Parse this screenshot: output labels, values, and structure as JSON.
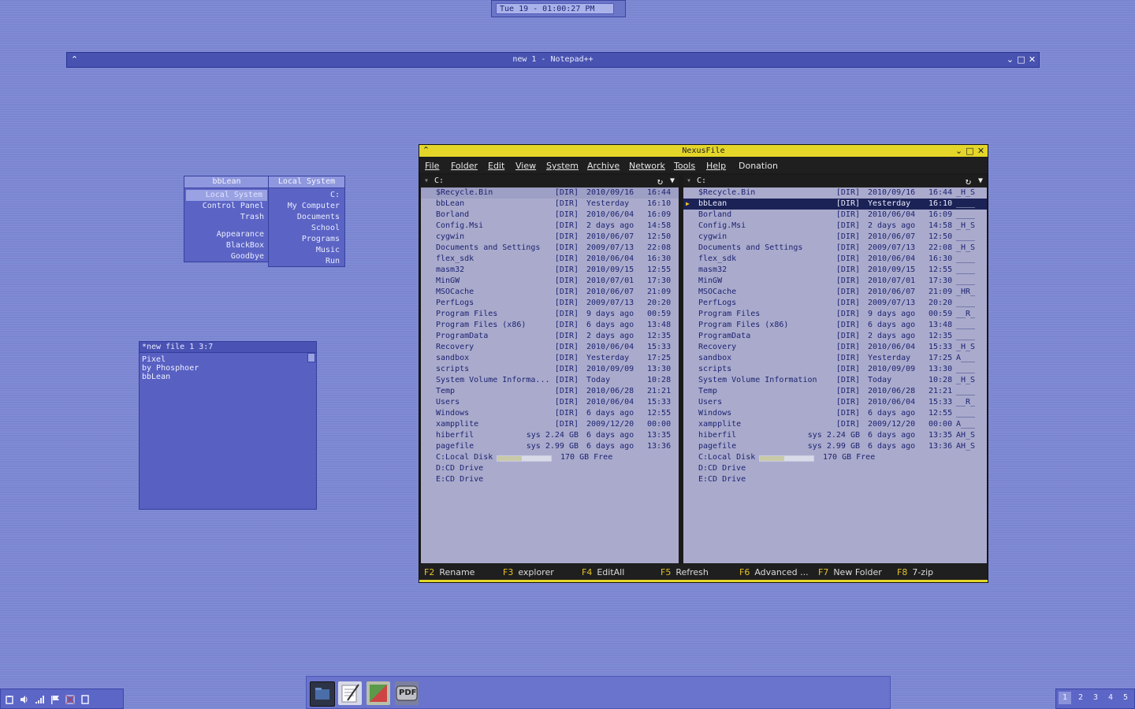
{
  "clock": {
    "text": "Tue 19 - 01:00:27 PM"
  },
  "notepad": {
    "title": "new  1 - Notepad++"
  },
  "bblean_menu": {
    "title": "bbLean",
    "items": [
      {
        "label": "Local System",
        "selected": true
      },
      {
        "label": "Control Panel"
      },
      {
        "label": "Trash"
      },
      {
        "label": "Appearance"
      },
      {
        "label": "BlackBox"
      },
      {
        "label": "Goodbye"
      }
    ]
  },
  "local_system_menu": {
    "title": "Local System",
    "items": [
      "C:",
      "My Computer",
      "Documents",
      "School",
      "Programs",
      "Music",
      "Run"
    ]
  },
  "editor": {
    "title": "*new file 1   3:7",
    "lines": [
      "Pixel",
      "by Phosphoer",
      "bbLean"
    ]
  },
  "nexusfile": {
    "title": "NexusFile",
    "menus": [
      "File",
      "Folder",
      "Edit",
      "View",
      "System",
      "Archive",
      "Network",
      "Tools",
      "Help",
      "Donation"
    ],
    "left_path": "C:",
    "right_path": "C:",
    "rows": [
      {
        "name": "$Recycle.Bin",
        "left_name": "$Recycle.Bin",
        "type": "[DIR]",
        "date": "2010/09/16",
        "time": "16:44",
        "attr": "_H_S"
      },
      {
        "name": "bbLean",
        "left_name": "bbLean",
        "type": "[DIR]",
        "date": "Yesterday",
        "time": "16:10",
        "attr": "____"
      },
      {
        "name": "Borland",
        "left_name": "Borland",
        "type": "[DIR]",
        "date": "2010/06/04",
        "time": "16:09",
        "attr": "____"
      },
      {
        "name": "Config.Msi",
        "left_name": "Config.Msi",
        "type": "[DIR]",
        "date": "2 days ago",
        "time": "14:58",
        "attr": "_H_S"
      },
      {
        "name": "cygwin",
        "left_name": "cygwin",
        "type": "[DIR]",
        "date": "2010/06/07",
        "time": "12:50",
        "attr": "____"
      },
      {
        "name": "Documents and Settings",
        "left_name": "Documents and Settings",
        "type": "[DIR]",
        "date": "2009/07/13",
        "time": "22:08",
        "attr": "_H_S"
      },
      {
        "name": "flex_sdk",
        "left_name": "flex_sdk",
        "type": "[DIR]",
        "date": "2010/06/04",
        "time": "16:30",
        "attr": "____"
      },
      {
        "name": "masm32",
        "left_name": "masm32",
        "type": "[DIR]",
        "date": "2010/09/15",
        "time": "12:55",
        "attr": "____"
      },
      {
        "name": "MinGW",
        "left_name": "MinGW",
        "type": "[DIR]",
        "date": "2010/07/01",
        "time": "17:30",
        "attr": "____"
      },
      {
        "name": "MSOCache",
        "left_name": "MSOCache",
        "type": "[DIR]",
        "date": "2010/06/07",
        "time": "21:09",
        "attr": "_HR_"
      },
      {
        "name": "PerfLogs",
        "left_name": "PerfLogs",
        "type": "[DIR]",
        "date": "2009/07/13",
        "time": "20:20",
        "attr": "____"
      },
      {
        "name": "Program Files",
        "left_name": "Program Files",
        "type": "[DIR]",
        "date": "9 days ago",
        "time": "00:59",
        "attr": "__R_"
      },
      {
        "name": "Program Files (x86)",
        "left_name": "Program Files (x86)",
        "type": "[DIR]",
        "date": "6 days ago",
        "time": "13:48",
        "attr": "____"
      },
      {
        "name": "ProgramData",
        "left_name": "ProgramData",
        "type": "[DIR]",
        "date": "2 days ago",
        "time": "12:35",
        "attr": "____"
      },
      {
        "name": "Recovery",
        "left_name": "Recovery",
        "type": "[DIR]",
        "date": "2010/06/04",
        "time": "15:33",
        "attr": "_H_S"
      },
      {
        "name": "sandbox",
        "left_name": "sandbox",
        "type": "[DIR]",
        "date": "Yesterday",
        "time": "17:25",
        "attr": "A___"
      },
      {
        "name": "scripts",
        "left_name": "scripts",
        "type": "[DIR]",
        "date": "2010/09/09",
        "time": "13:30",
        "attr": "____"
      },
      {
        "name": "System Volume Information",
        "left_name": "System Volume Informa...",
        "type": "[DIR]",
        "date": "Today",
        "time": "10:28",
        "attr": "_H_S"
      },
      {
        "name": "Temp",
        "left_name": "Temp",
        "type": "[DIR]",
        "date": "2010/06/28",
        "time": "21:21",
        "attr": "____"
      },
      {
        "name": "Users",
        "left_name": "Users",
        "type": "[DIR]",
        "date": "2010/06/04",
        "time": "15:33",
        "attr": "__R_"
      },
      {
        "name": "Windows",
        "left_name": "Windows",
        "type": "[DIR]",
        "date": "6 days ago",
        "time": "12:55",
        "attr": "____"
      },
      {
        "name": "xampplite",
        "left_name": "xampplite",
        "type": "[DIR]",
        "date": "2009/12/20",
        "time": "00:00",
        "attr": "A___"
      },
      {
        "name": "hiberfil",
        "left_name": "hiberfil",
        "type": "sys  2.24 GB",
        "date": "6 days ago",
        "time": "13:35",
        "attr": "AH_S"
      },
      {
        "name": "pagefile",
        "left_name": "pagefile",
        "type": "sys  2.99 GB",
        "date": "6 days ago",
        "time": "13:36",
        "attr": "AH_S"
      }
    ],
    "left_top_index": 0,
    "right_selected_index": 1,
    "drives": [
      {
        "label": "C:Local Disk",
        "free": "170 GB Free",
        "used_fraction": 0.45
      },
      {
        "label": "D:CD Drive"
      },
      {
        "label": "E:CD Drive"
      }
    ],
    "function_keys": [
      {
        "key": "F2",
        "label": "Rename"
      },
      {
        "key": "F3",
        "label": "explorer"
      },
      {
        "key": "F4",
        "label": "EditAll"
      },
      {
        "key": "F5",
        "label": "Refresh"
      },
      {
        "key": "F6",
        "label": "Advanced ..."
      },
      {
        "key": "F7",
        "label": "New Folder"
      },
      {
        "key": "F8",
        "label": "7-zip"
      }
    ]
  },
  "workspaces": [
    "1",
    "2",
    "3",
    "4",
    "5"
  ],
  "dock_icons": [
    "file-manager-icon",
    "notepad-icon",
    "paint-icon",
    "pdf-icon"
  ],
  "dock_pdf_label": "PDF",
  "tray_icons": [
    "clipboard-icon",
    "volume-icon",
    "signal-icon",
    "flag-icon",
    "network-icon",
    "document-icon"
  ],
  "colors": {
    "accent": "#e4d629",
    "desktop": "#7b86d2",
    "pane": "#aaabcc",
    "selection": "#1b2256"
  }
}
